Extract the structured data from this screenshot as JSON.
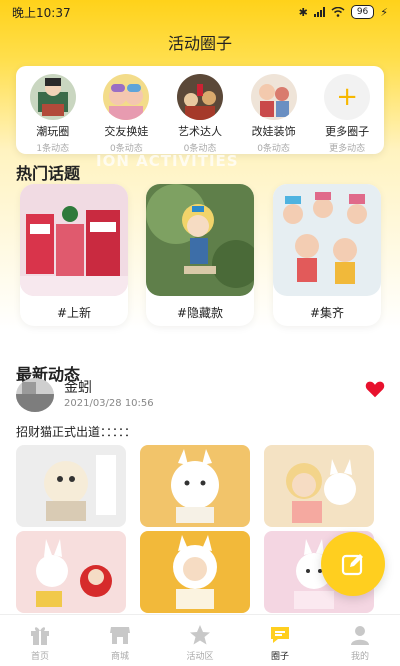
{
  "status_bar": {
    "time": "晚上10:37",
    "battery": "96"
  },
  "nav": {
    "title": "活动圈子"
  },
  "circles": [
    {
      "name": "潮玩圈",
      "count": "1条动态"
    },
    {
      "name": "交友换娃",
      "count": "0条动态"
    },
    {
      "name": "艺术达人",
      "count": "0条动态"
    },
    {
      "name": "改娃装饰",
      "count": "0条动态"
    },
    {
      "name": "更多圈子",
      "count": "更多动态"
    }
  ],
  "background_text": "ION ACTIVITIES",
  "hot_topics": {
    "title": "热门话题",
    "items": [
      {
        "label": "#上新"
      },
      {
        "label": "#隐藏款"
      },
      {
        "label": "#集齐"
      }
    ]
  },
  "latest": {
    "title": "最新动态",
    "post": {
      "user": "金蚓",
      "time": "2021/03/28 10:56",
      "text": "招财猫正式出道：：：：："
    }
  },
  "tabs": [
    {
      "label": "首页",
      "icon": "gift-icon"
    },
    {
      "label": "商城",
      "icon": "store-icon"
    },
    {
      "label": "活动区",
      "icon": "star-icon"
    },
    {
      "label": "圈子",
      "icon": "chat-icon",
      "active": true
    },
    {
      "label": "我的",
      "icon": "person-icon"
    }
  ],
  "colors": {
    "accent": "#ffcf1f",
    "heart": "#e8112d",
    "inactive": "#aaaaaa"
  }
}
